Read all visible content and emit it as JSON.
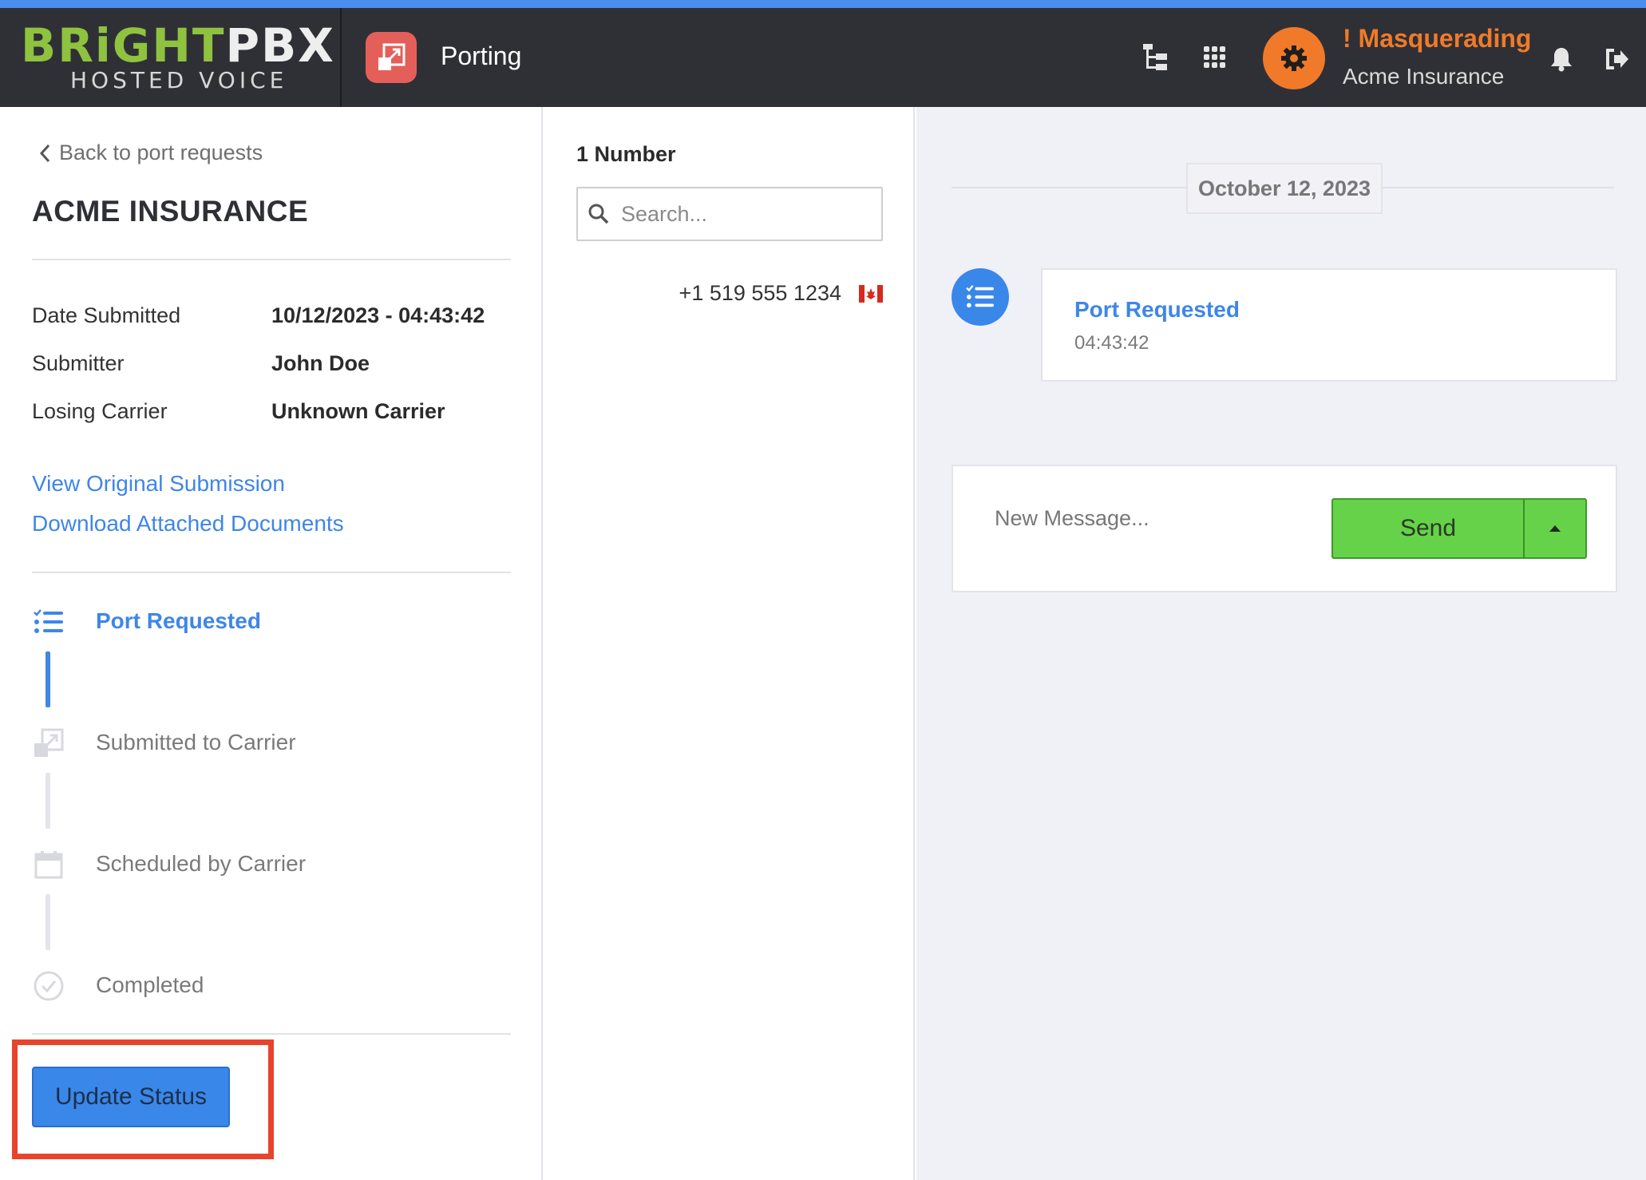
{
  "header": {
    "brand_main_1": "BRiGHT",
    "brand_main_2": "PBX",
    "brand_sub": "HOSTED VOICE",
    "app_title": "Porting",
    "masquerading_label": "! Masquerading",
    "account_name": "Acme Insurance",
    "icons": [
      "hierarchy-icon",
      "apps-grid-icon",
      "gear-icon",
      "bell-icon",
      "logout-icon"
    ],
    "colors": {
      "accent_bar": "#4a8ef0",
      "topbar": "#2f3035",
      "masquerade": "#f07a2a",
      "porting_icon": "#e55f5a"
    }
  },
  "left_panel": {
    "back_link": "Back to port requests",
    "company": "ACME INSURANCE",
    "info": [
      {
        "label": "Date Submitted",
        "value": "10/12/2023 - 04:43:42"
      },
      {
        "label": "Submitter",
        "value": "John Doe"
      },
      {
        "label": "Losing Carrier",
        "value": "Unknown Carrier"
      }
    ],
    "links": [
      "View Original Submission",
      "Download Attached Documents"
    ],
    "steps": [
      {
        "label": "Port Requested",
        "state": "active",
        "icon": "checklist-icon"
      },
      {
        "label": "Submitted to Carrier",
        "state": "pending",
        "icon": "transfer-icon"
      },
      {
        "label": "Scheduled by Carrier",
        "state": "pending",
        "icon": "calendar-icon"
      },
      {
        "label": "Completed",
        "state": "pending",
        "icon": "check-circle-icon"
      }
    ],
    "update_button": "Update Status"
  },
  "middle_panel": {
    "count_label": "1 Number",
    "search_placeholder": "Search...",
    "numbers": [
      {
        "number": "+1 519 555 1234",
        "country_icon": "canada-flag-icon"
      }
    ]
  },
  "right_panel": {
    "date_label": "October 12, 2023",
    "events": [
      {
        "title": "Port Requested",
        "time": "04:43:42",
        "icon": "checklist-icon"
      }
    ],
    "message_placeholder": "New Message...",
    "send_label": "Send"
  }
}
